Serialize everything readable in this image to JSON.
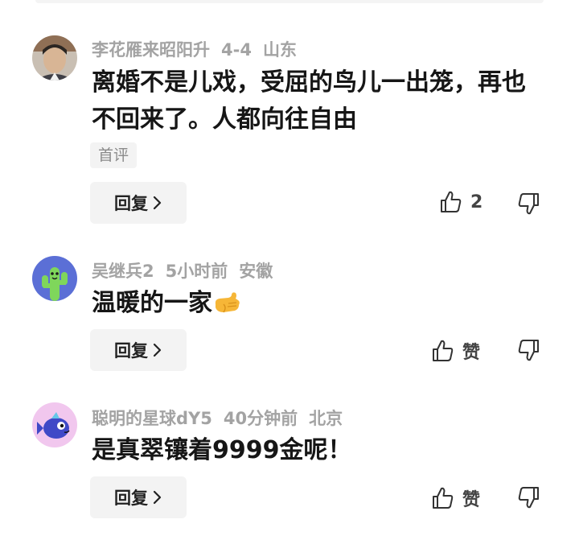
{
  "comments": [
    {
      "user": "李花雁来昭阳升",
      "time": "4-4",
      "location": "山东",
      "text": "离婚不是儿戏，受屈的鸟儿一出笼，再也不回来了。人都向往自由",
      "tag": "首评",
      "reply_label": "回复",
      "like_label": "2"
    },
    {
      "user": "吴继兵2",
      "time": "5小时前",
      "location": "安徽",
      "text": "温暖的一家",
      "emoji": "call-me-hand-emoji",
      "reply_label": "回复",
      "like_label": "赞"
    },
    {
      "user": "聪明的星球dY5",
      "time": "40分钟前",
      "location": "北京",
      "text": "是真翠镶着9999金呢！",
      "reply_label": "回复",
      "like_label": "赞"
    }
  ]
}
